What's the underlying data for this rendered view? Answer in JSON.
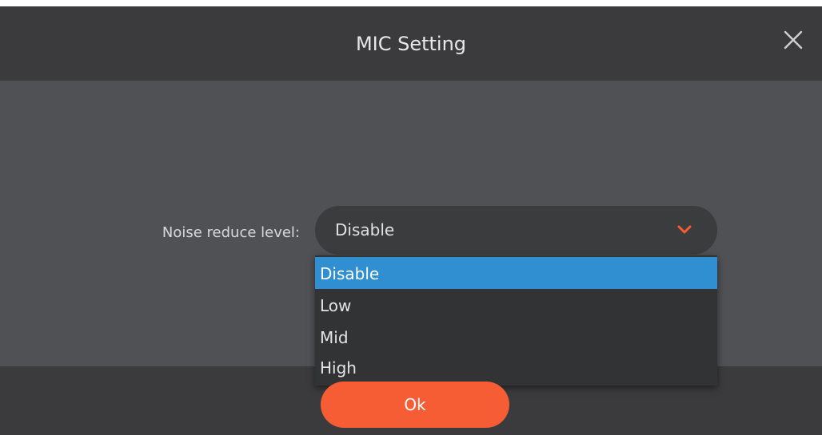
{
  "dialog": {
    "title": "MIC Setting",
    "close_icon": "close-icon"
  },
  "form": {
    "noise_label": "Noise reduce level:",
    "noise_value": "Disable",
    "chevron_icon": "chevron-down-icon",
    "options": [
      "Disable",
      "Low",
      "Mid",
      "High"
    ],
    "selected_index": 0
  },
  "footer": {
    "ok_label": "Ok"
  },
  "colors": {
    "accent": "#f65d34",
    "selection": "#2f8fd0",
    "panel": "#505155",
    "bar": "#3b3b3d"
  }
}
